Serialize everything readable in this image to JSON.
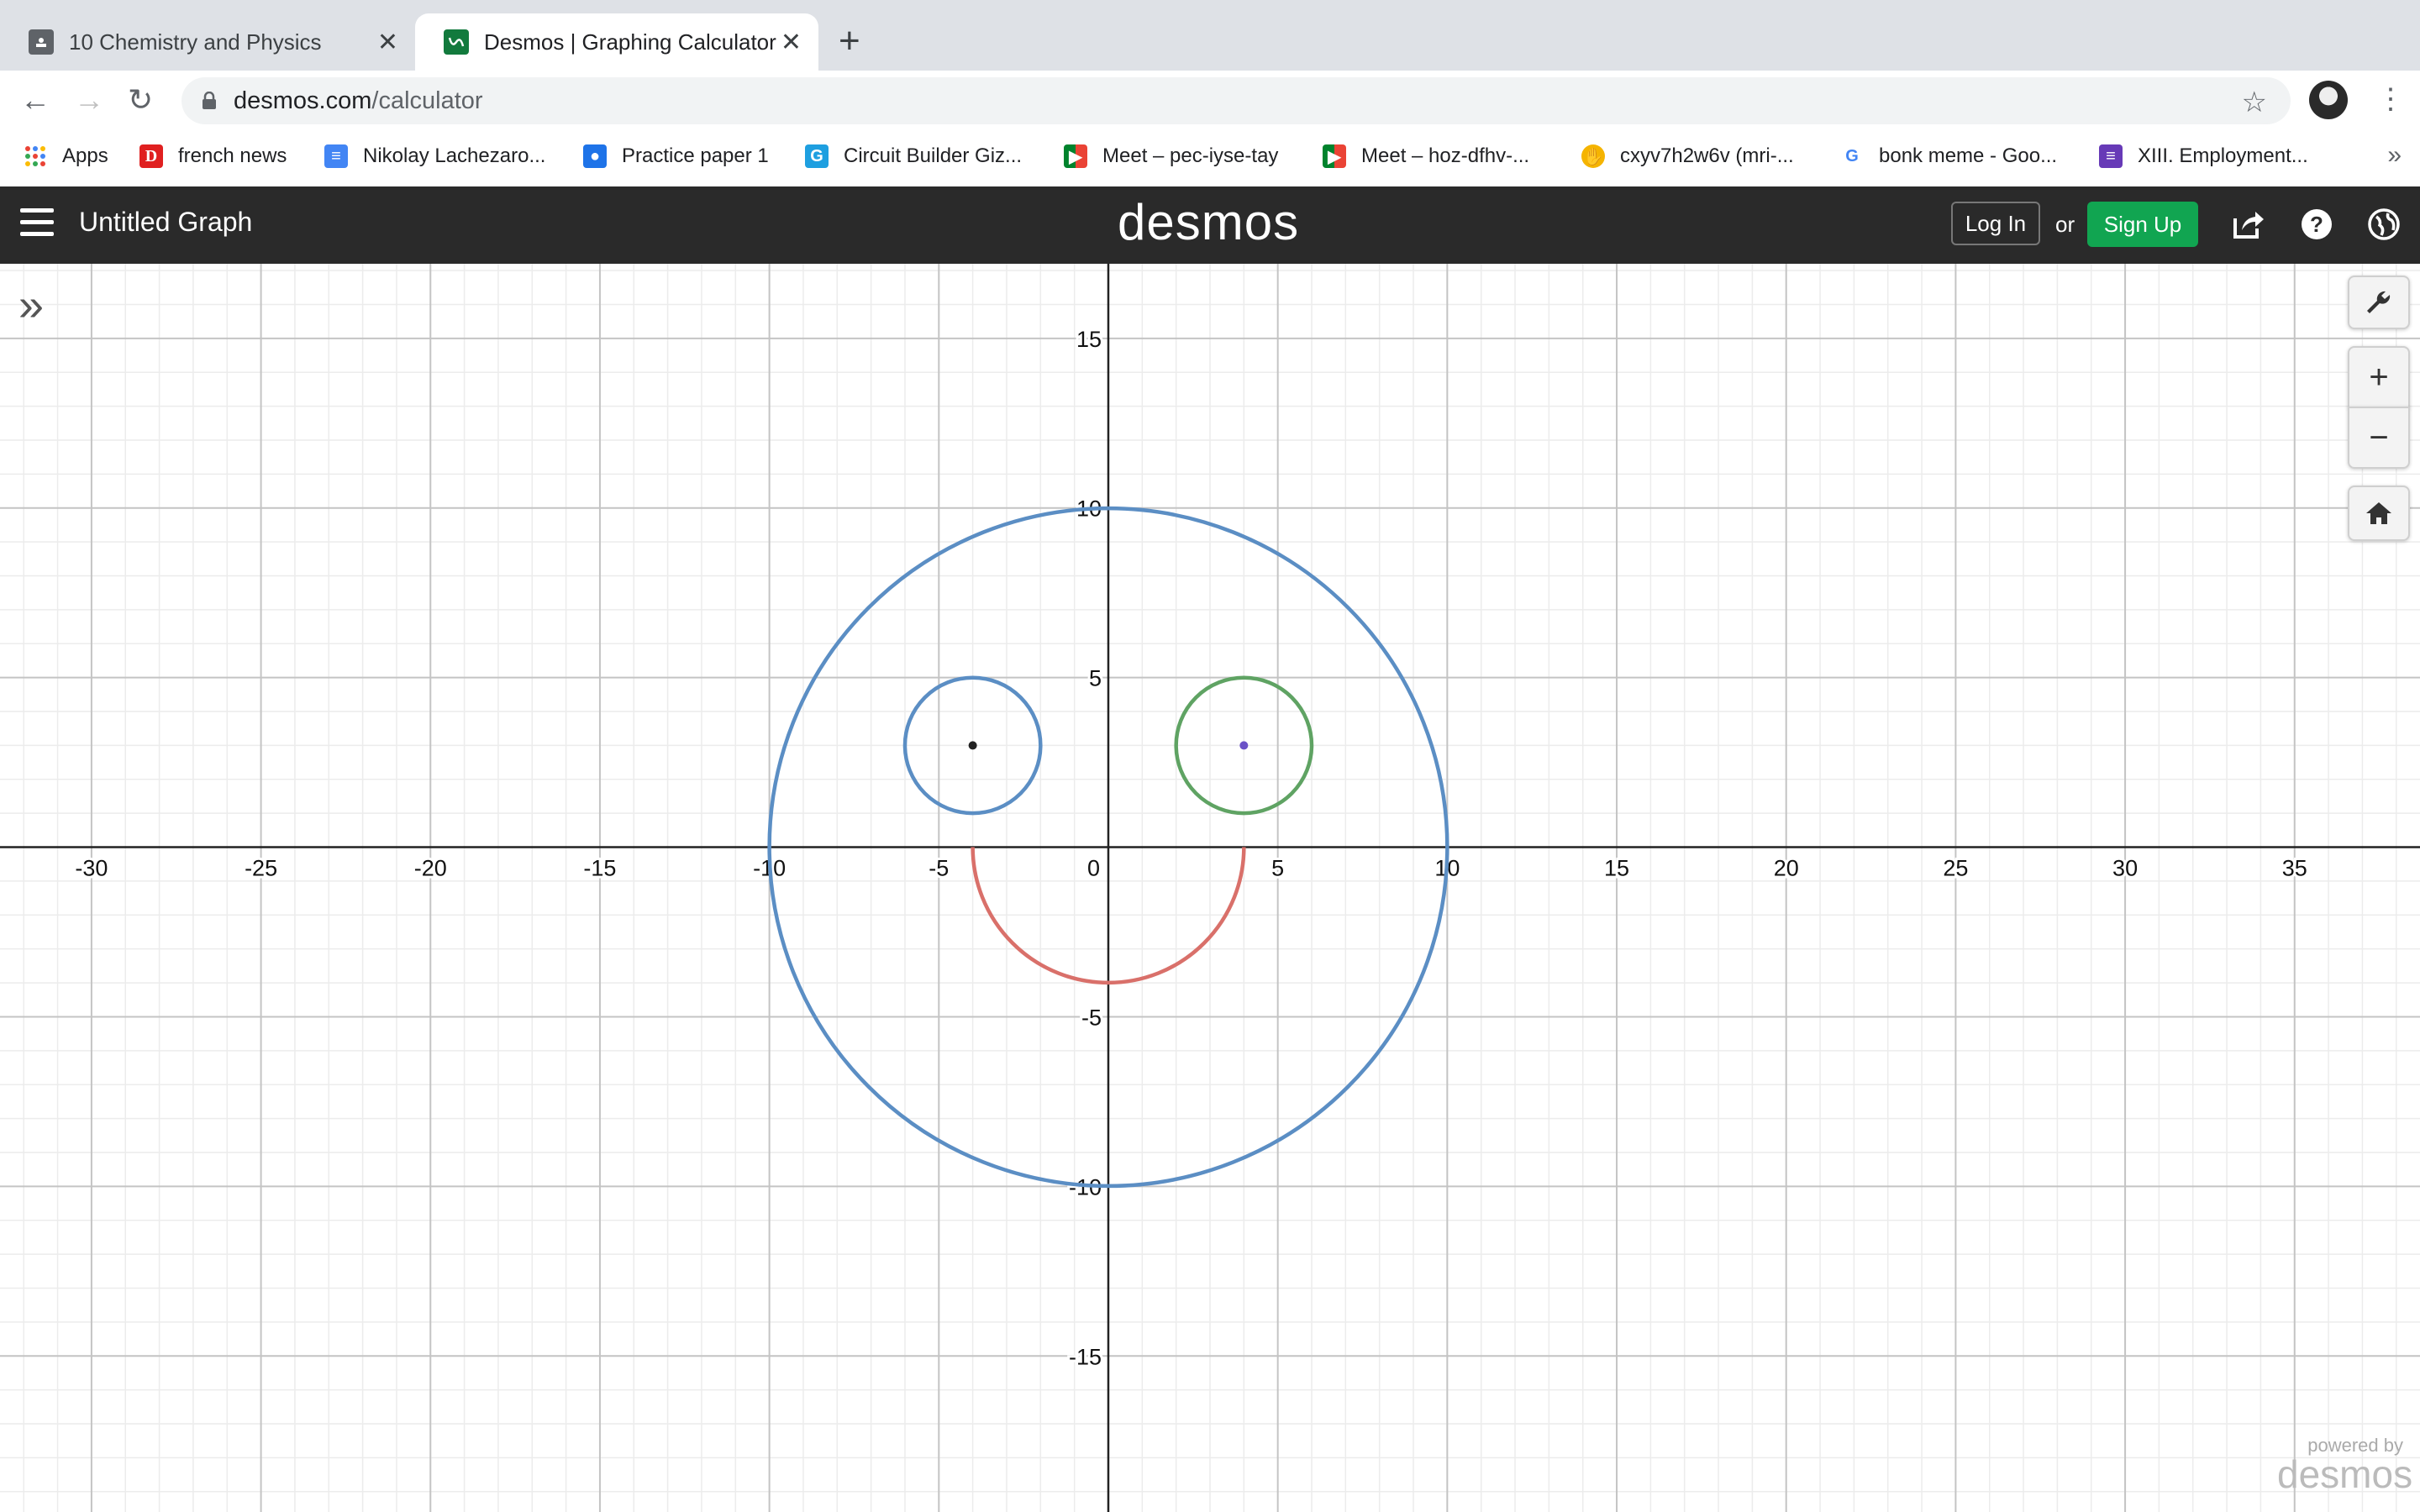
{
  "browser": {
    "tabs": [
      {
        "title": "10 Chemistry and Physics",
        "active": false
      },
      {
        "title": "Desmos | Graphing Calculator",
        "active": true
      }
    ],
    "url_host": "desmos.com",
    "url_path": "/calculator",
    "bookmarks": [
      {
        "label": "Apps",
        "icon": "apps-grid-icon"
      },
      {
        "label": "french news",
        "icon": "d-letter-icon"
      },
      {
        "label": "Nikolay Lachezaro...",
        "icon": "docs-icon"
      },
      {
        "label": "Practice paper 1",
        "icon": "classroom-icon"
      },
      {
        "label": "Circuit Builder Giz...",
        "icon": "g-letter-icon"
      },
      {
        "label": "Meet – pec-iyse-tay",
        "icon": "meet-icon"
      },
      {
        "label": "Meet – hoz-dfhv-...",
        "icon": "meet-icon"
      },
      {
        "label": "cxyv7h2w6v (mri-...",
        "icon": "hand-icon"
      },
      {
        "label": "bonk meme - Goo...",
        "icon": "google-icon"
      },
      {
        "label": "XIII. Employment...",
        "icon": "forms-icon"
      }
    ],
    "more_bookmarks": "»"
  },
  "desmos": {
    "graph_title": "Untitled Graph",
    "logo": "desmos",
    "login_label": "Log In",
    "or_label": "or",
    "signup_label": "Sign Up",
    "powered_by": "powered by",
    "powered_logo": "desmos"
  },
  "colors": {
    "blue": "#5b8ec4",
    "green": "#5fa363",
    "red": "#d9706a",
    "purple": "#6b52c7",
    "signup": "#11a551"
  },
  "graph": {
    "x_range": [
      -32.7,
      38.7
    ],
    "y_range": [
      -19.6,
      17.2
    ],
    "x_ticks": [
      -30,
      -25,
      -20,
      -15,
      -10,
      -5,
      0,
      5,
      10,
      15,
      20,
      25,
      30,
      35
    ],
    "y_ticks": [
      15,
      10,
      5,
      -5,
      -10,
      -15
    ],
    "minor_step": 1,
    "major_step": 5,
    "curves": [
      {
        "type": "circle",
        "cx": 0,
        "cy": 0,
        "r": 10,
        "color": "blue"
      },
      {
        "type": "circle",
        "cx": -4,
        "cy": 3,
        "r": 2,
        "color": "blue"
      },
      {
        "type": "circle",
        "cx": 4,
        "cy": 3,
        "r": 2,
        "color": "green"
      },
      {
        "type": "lower-semicircle",
        "cx": 0,
        "cy": 0,
        "r": 4,
        "color": "red"
      }
    ],
    "points": [
      {
        "x": -4,
        "y": 3,
        "color": "#222222"
      },
      {
        "x": 4,
        "y": 3,
        "color": "purple"
      }
    ]
  }
}
